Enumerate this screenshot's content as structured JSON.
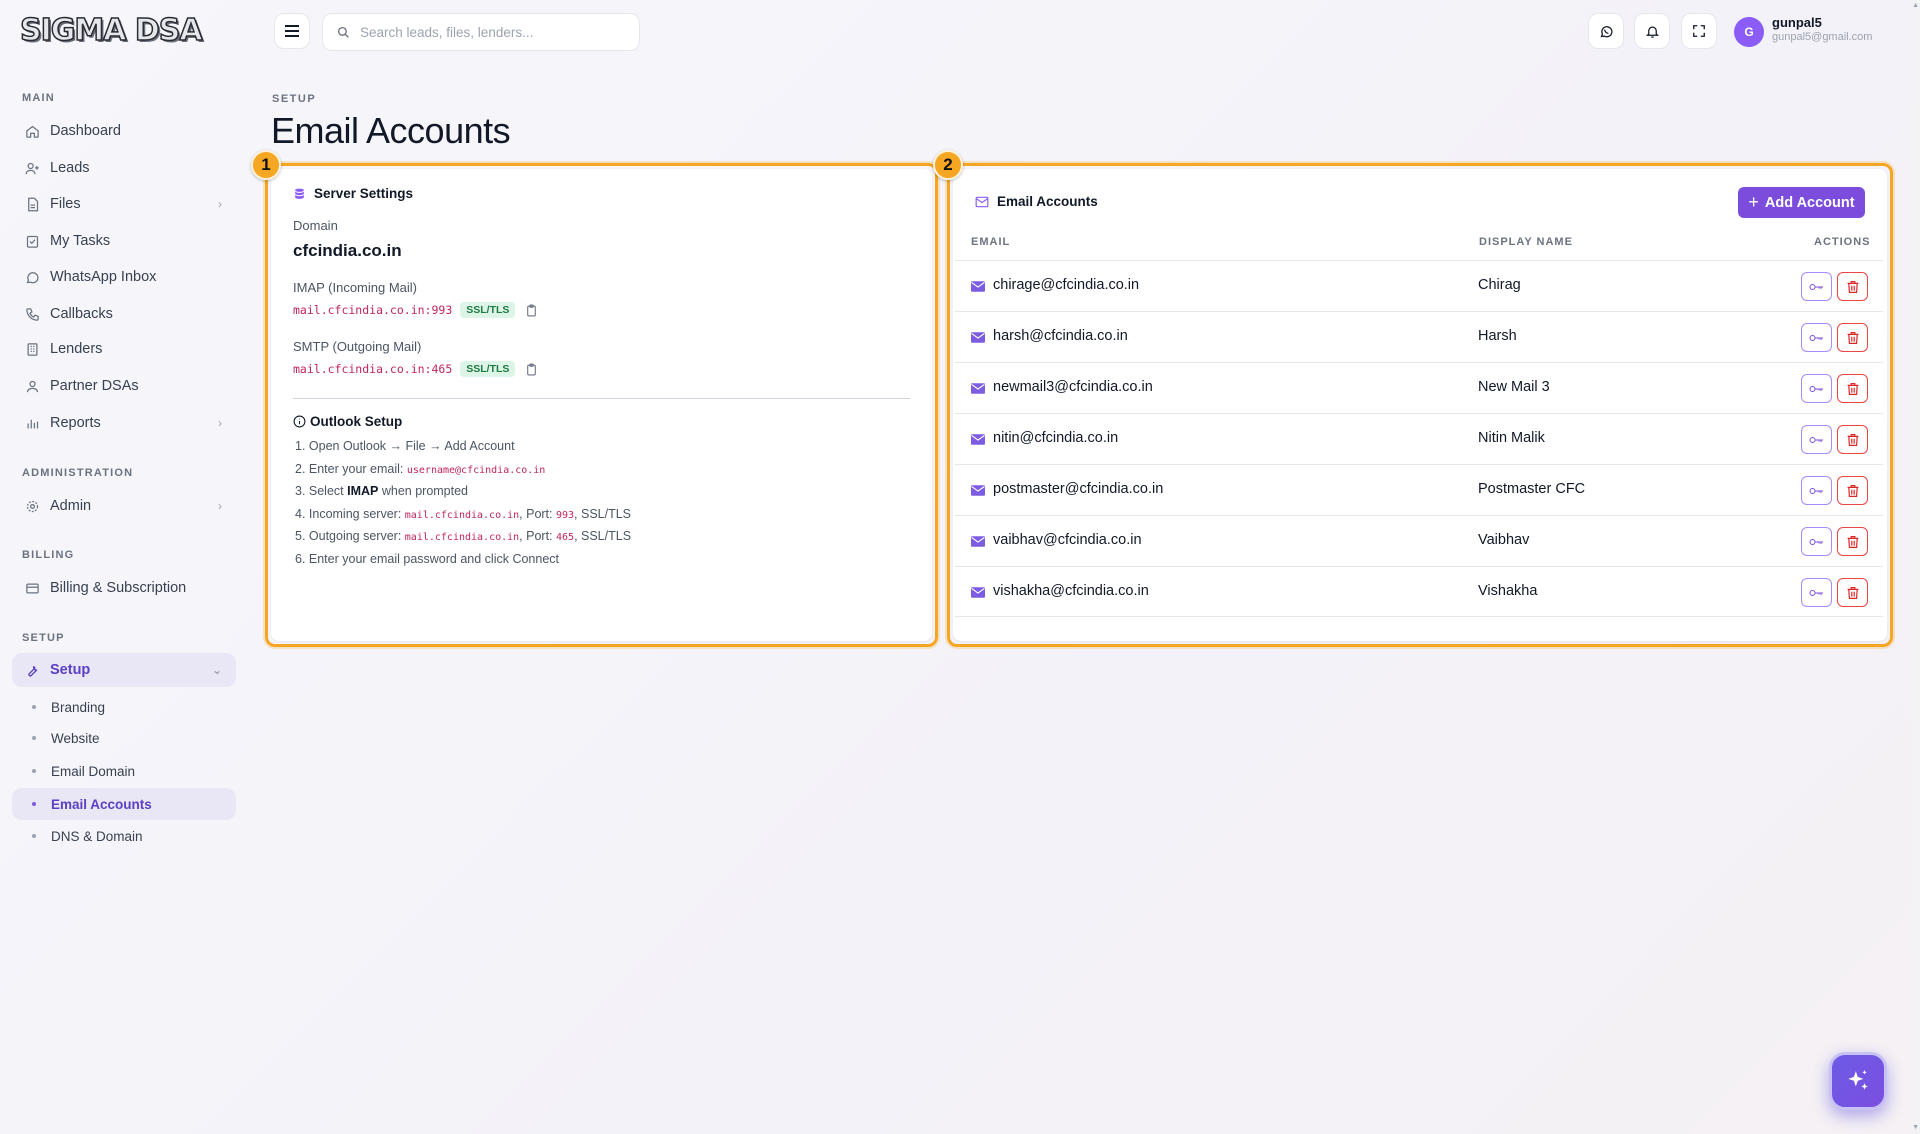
{
  "brand": {
    "logo": "SIGMA DSA"
  },
  "topbar": {
    "search_placeholder": "Search leads, files, lenders...",
    "user": {
      "initial": "G",
      "name": "gunpal5",
      "email": "gunpal5@gmail.com"
    }
  },
  "sidebar": {
    "sections": {
      "main": "MAIN",
      "administration": "ADMINISTRATION",
      "billing": "BILLING",
      "setup": "SETUP"
    },
    "main_items": [
      "Dashboard",
      "Leads",
      "Files",
      "My Tasks",
      "WhatsApp Inbox",
      "Callbacks",
      "Lenders",
      "Partner DSAs",
      "Reports"
    ],
    "admin_item": "Admin",
    "billing_item": "Billing & Subscription",
    "setup_item": "Setup",
    "setup_sub": [
      "Branding",
      "Website",
      "Email Domain",
      "Email Accounts",
      "DNS & Domain"
    ]
  },
  "page": {
    "breadcrumb": "SETUP",
    "title": "Email Accounts"
  },
  "server_settings": {
    "badge": "1",
    "title": "Server Settings",
    "domain_label": "Domain",
    "domain": "cfcindia.co.in",
    "imap_label": "IMAP (Incoming Mail)",
    "imap_host": "mail.cfcindia.co.in:993",
    "smtp_label": "SMTP (Outgoing Mail)",
    "smtp_host": "mail.cfcindia.co.in:465",
    "ssl": "SSL/TLS",
    "outlook_title": "Outlook Setup",
    "steps": {
      "s1": "1. Open Outlook → File → Add Account",
      "s2_pre": "2. Enter your email: ",
      "s2_code": "username@cfcindia.co.in",
      "s3_pre": "3. Select ",
      "s3_bold": "IMAP",
      "s3_post": " when prompted",
      "s4_pre": "4. Incoming server: ",
      "s4_host": "mail.cfcindia.co.in",
      "s4_mid": ", Port: ",
      "s4_port": "993",
      "s4_post": ", SSL/TLS",
      "s5_pre": "5. Outgoing server: ",
      "s5_host": "mail.cfcindia.co.in",
      "s5_mid": ", Port: ",
      "s5_port": "465",
      "s5_post": ", SSL/TLS",
      "s6": "6. Enter your email password and click Connect"
    }
  },
  "email_accounts": {
    "badge": "2",
    "title": "Email Accounts",
    "add_label": "Add Account",
    "columns": {
      "email": "EMAIL",
      "display_name": "DISPLAY NAME",
      "actions": "ACTIONS"
    },
    "rows": [
      {
        "email": "chirage@cfcindia.co.in",
        "name": "Chirag"
      },
      {
        "email": "harsh@cfcindia.co.in",
        "name": "Harsh"
      },
      {
        "email": "newmail3@cfcindia.co.in",
        "name": "New Mail 3"
      },
      {
        "email": "nitin@cfcindia.co.in",
        "name": "Nitin Malik"
      },
      {
        "email": "postmaster@cfcindia.co.in",
        "name": "Postmaster CFC"
      },
      {
        "email": "vaibhav@cfcindia.co.in",
        "name": "Vaibhav"
      },
      {
        "email": "vishakha@cfcindia.co.in",
        "name": "Vishakha"
      }
    ]
  },
  "colors": {
    "accent": "#7c4ddc",
    "highlight": "#f5a623",
    "danger": "#dc2626",
    "code": "#c2255c"
  }
}
